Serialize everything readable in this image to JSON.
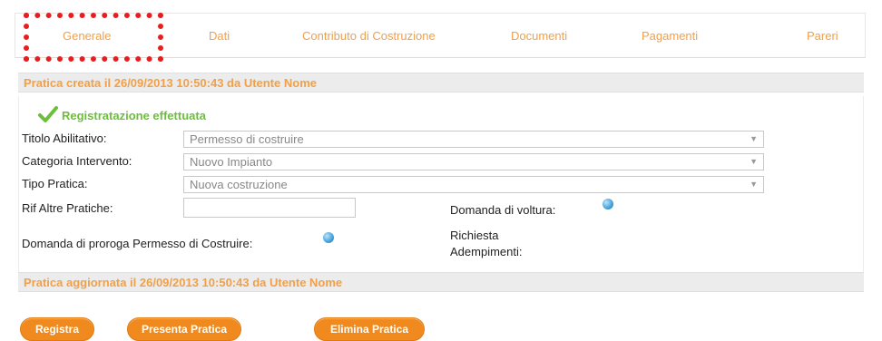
{
  "tabs": [
    {
      "label": "Generale"
    },
    {
      "label": "Dati"
    },
    {
      "label": "Contributo di Costruzione"
    },
    {
      "label": "Documenti"
    },
    {
      "label": "Pagamenti"
    },
    {
      "label": "Pareri"
    }
  ],
  "header": {
    "created": "Pratica creata il 26/09/2013 10:50:43 da Utente Nome"
  },
  "status": {
    "message": "Registratazione effettuata",
    "icon": "check-icon",
    "color": "#6bbf3a"
  },
  "form": {
    "titolo": {
      "label": "Titolo Abilitativo:",
      "value": "Permesso di costruire"
    },
    "categoria": {
      "label": "Categoria Intervento:",
      "value": "Nuovo Impianto"
    },
    "tipo": {
      "label": "Tipo Pratica:",
      "value": "Nuova costruzione"
    },
    "rif": {
      "label": "Rif Altre Pratiche:",
      "value": ""
    },
    "voltura": {
      "label": "Domanda di voltura:"
    },
    "proroga": {
      "label": "Domanda di proroga Permesso di Costruire:"
    },
    "richiesta": {
      "label_line1": "Richiesta",
      "label_line2": "Adempimenti:"
    }
  },
  "footer": {
    "updated": "Pratica aggiornata il 26/09/2013 10:50:43 da Utente Nome"
  },
  "buttons": {
    "registra": "Registra",
    "presenta": "Presenta Pratica",
    "elimina": "Elimina Pratica"
  },
  "colors": {
    "accent": "#f0a04a",
    "button": "#f08a1e",
    "highlight": "#e81e1e"
  }
}
